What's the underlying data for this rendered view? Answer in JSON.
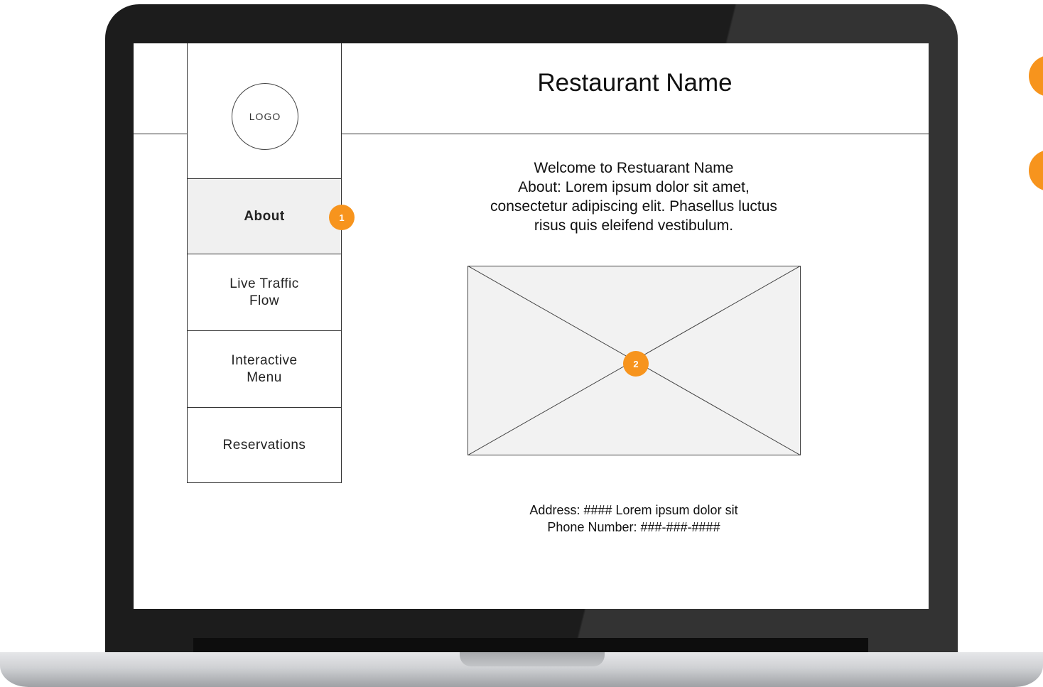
{
  "header": {
    "title": "Restaurant Name"
  },
  "sidebar": {
    "logo_text": "LOGO",
    "items": [
      {
        "label": "About",
        "active": true
      },
      {
        "label": "Live Traffic\nFlow",
        "active": false
      },
      {
        "label": "Interactive\nMenu",
        "active": false
      },
      {
        "label": "Reservations",
        "active": false
      }
    ]
  },
  "main": {
    "intro_lines": [
      "Welcome to Restuarant Name",
      "About: Lorem ipsum dolor sit amet,",
      "consectetur adipiscing elit. Phasellus luctus",
      "risus quis eleifend vestibulum."
    ],
    "address_line": "Address: #### Lorem ipsum dolor sit",
    "phone_line": "Phone Number: ###-###-####"
  },
  "annotations": [
    {
      "label": "1",
      "target": "about nav item"
    },
    {
      "label": "2",
      "target": "image placeholder"
    }
  ],
  "colors": {
    "accent": "#f7941d",
    "bezel": "#1c1c1c",
    "active_bg": "#f0f0f0",
    "placeholder_bg": "#f2f2f2",
    "line": "#333333"
  },
  "icons": {
    "image_placeholder": "image-placeholder-icon"
  }
}
